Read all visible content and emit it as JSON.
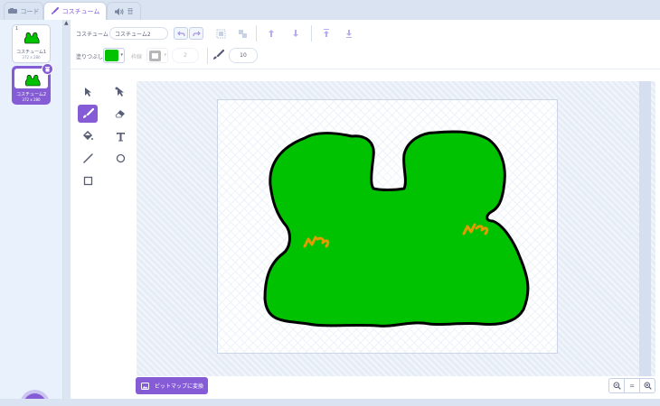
{
  "tabs": [
    {
      "label": "コード",
      "icon": "code-icon"
    },
    {
      "label": "コスチューム",
      "icon": "brush-icon"
    },
    {
      "label": "音",
      "icon": "speaker-icon"
    }
  ],
  "costumes": [
    {
      "num": "1",
      "name": "コスチューム1",
      "size": "372 x 280"
    },
    {
      "num": "2",
      "name": "コスチューム2",
      "size": "372 x 280"
    }
  ],
  "toolbar": {
    "costume_label": "コスチューム",
    "costume_name": "コスチューム2",
    "fill_label": "塗りつぶし",
    "outline_label": "枠線",
    "outline_width": "2",
    "brush_size": "10"
  },
  "bitmap_button": "ビットマップに変換",
  "zoom_reset": "=",
  "colors": {
    "accent": "#855cd6",
    "fill": "#00c200",
    "outline": "#000000",
    "mark": "#e39b00"
  }
}
